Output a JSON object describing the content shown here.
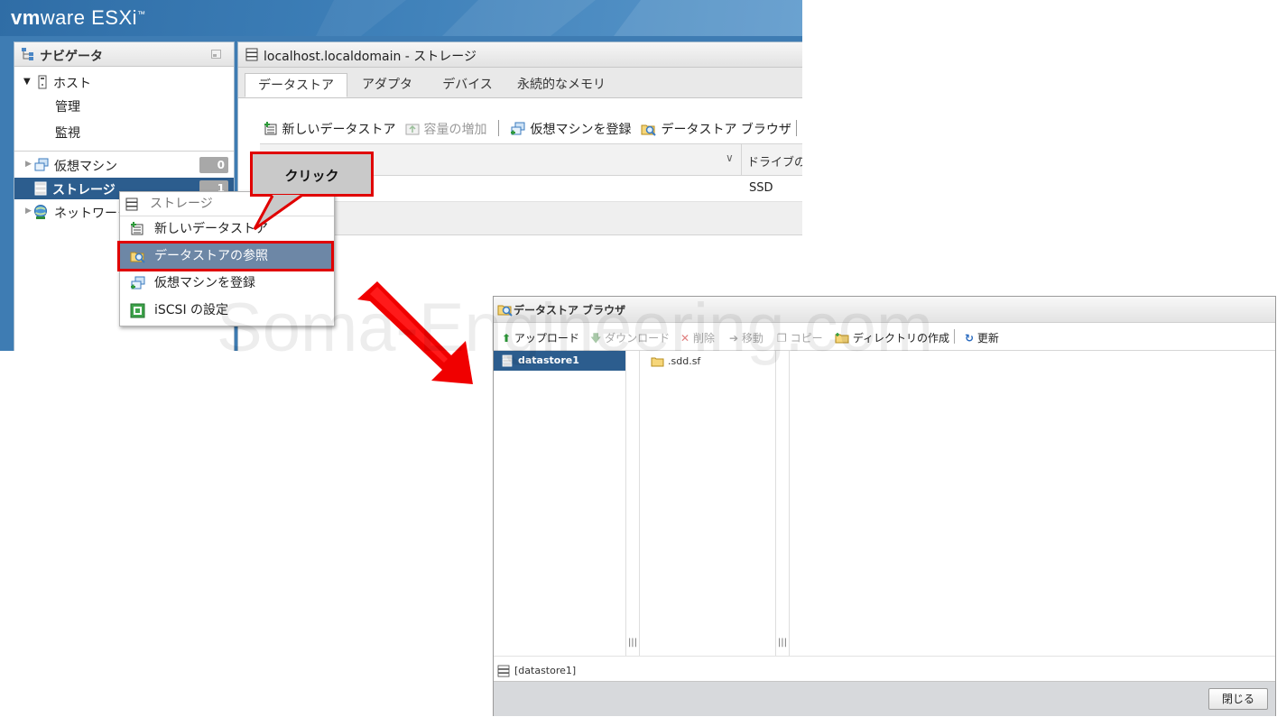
{
  "esxi": {
    "brand_prefix": "vm",
    "brand_rest": "ware ESXi",
    "brand_tm": "™"
  },
  "navigator": {
    "title": "ナビゲータ",
    "host": {
      "label": "ホスト",
      "children": [
        "管理",
        "監視"
      ]
    },
    "items": [
      {
        "label": "仮想マシン",
        "badge": "0"
      },
      {
        "label": "ストレージ",
        "badge": "1"
      },
      {
        "label": "ネットワーク"
      }
    ]
  },
  "main": {
    "title": "localhost.localdomain - ストレージ",
    "tabs": [
      "データストア",
      "アダプタ",
      "デバイス",
      "永続的なメモリ"
    ],
    "active_tab": "データストア",
    "toolbar": [
      {
        "label": "新しいデータストア",
        "enabled": true
      },
      {
        "label": "容量の増加",
        "enabled": false
      },
      {
        "label": "仮想マシンを登録",
        "enabled": true
      },
      {
        "label": "データストア ブラウザ",
        "enabled": true
      }
    ],
    "grid": {
      "column_header": "ドライブの",
      "row_value": "SSD"
    }
  },
  "context_menu": {
    "header": "ストレージ",
    "items": [
      "新しいデータストア",
      "データストアの参照",
      "仮想マシンを登録",
      "iSCSI の設定"
    ],
    "highlighted": "データストアの参照"
  },
  "annotation": {
    "callout_text": "クリック"
  },
  "datastore_browser": {
    "title": "データストア ブラウザ",
    "toolbar": [
      {
        "label": "アップロード",
        "enabled": true
      },
      {
        "label": "ダウンロード",
        "enabled": false
      },
      {
        "label": "削除",
        "enabled": false
      },
      {
        "label": "移動",
        "enabled": false
      },
      {
        "label": "コピー",
        "enabled": false
      },
      {
        "label": "ディレクトリの作成",
        "enabled": true
      },
      {
        "label": "更新",
        "enabled": true
      }
    ],
    "tree_selected": "datastore1",
    "folder": ".sdd.sf",
    "status_path": "[datastore1]",
    "close_label": "閉じる"
  },
  "watermark": "Soma-Engineering.com",
  "colors": {
    "esxi_blue": "#3e7cb3",
    "selection": "#2c5d8e",
    "menu_highlight": "#6d87a6",
    "annotation_red": "#e00000"
  }
}
